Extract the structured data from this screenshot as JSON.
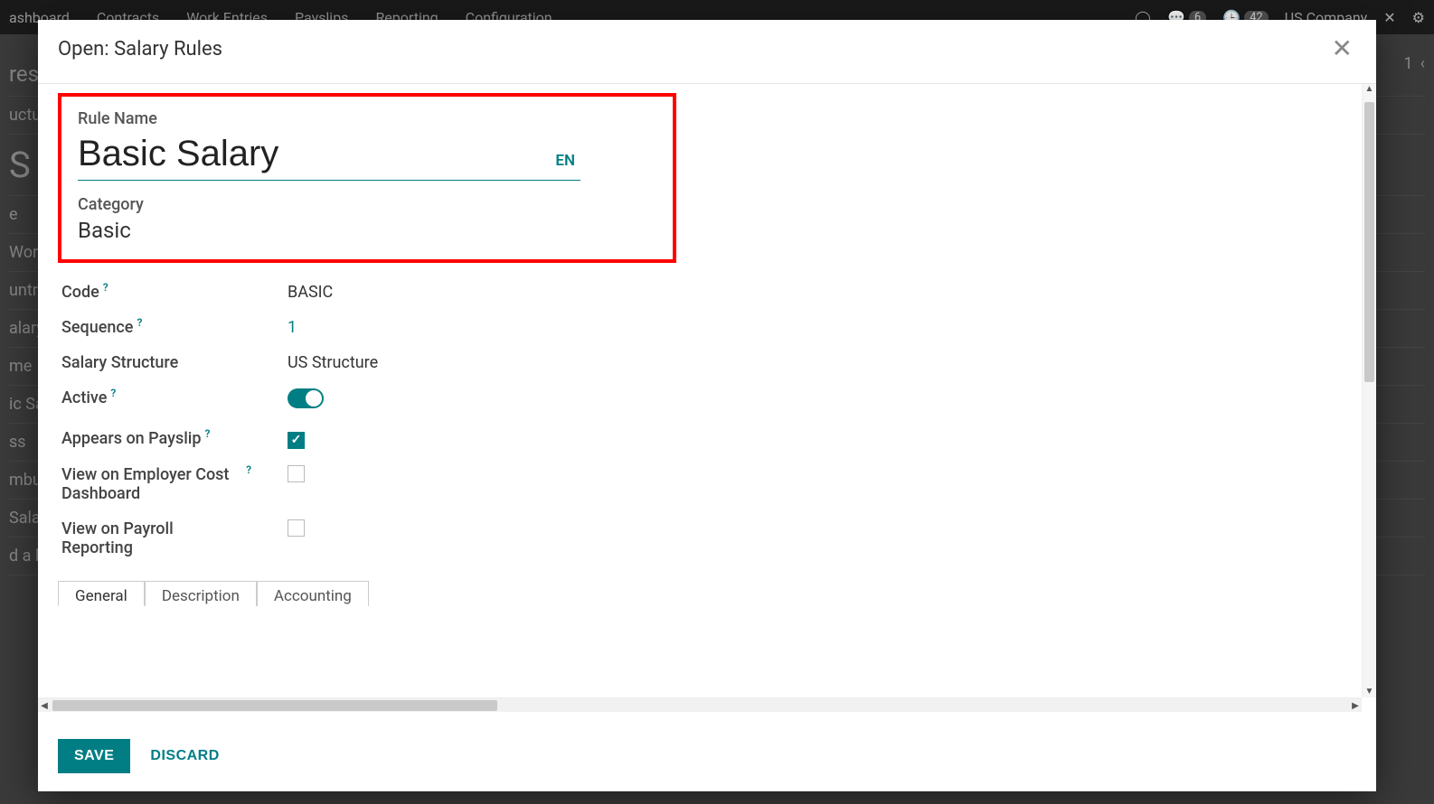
{
  "background": {
    "nav": [
      "ashboard",
      "Contracts",
      "Work Entries",
      "Payslips",
      "Reporting",
      "Configuration"
    ],
    "nav_right": {
      "chat_count": "6",
      "clock_count": "42",
      "company": "US Company"
    },
    "pager": "1",
    "left_fragments": [
      "res",
      "uctur",
      "S",
      "e",
      " Wor",
      "untry",
      "alary",
      "me",
      "ic Sa",
      "ss",
      "mbur",
      " Sala",
      "d a li"
    ]
  },
  "modal": {
    "title": "Open: Salary Rules",
    "rule_name_label": "Rule Name",
    "rule_name_value": "Basic Salary",
    "lang_badge": "EN",
    "category_label": "Category",
    "category_value": "Basic",
    "fields": {
      "code_label": "Code",
      "code_value": "BASIC",
      "sequence_label": "Sequence",
      "sequence_value": "1",
      "structure_label": "Salary Structure",
      "structure_value": "US Structure",
      "active_label": "Active",
      "appears_label": "Appears on Payslip",
      "employer_cost_label": "View on Employer Cost Dashboard",
      "payroll_reporting_label": "View on Payroll Reporting"
    },
    "tabs": [
      "General",
      "Description",
      "Accounting"
    ],
    "footer": {
      "save": "SAVE",
      "discard": "DISCARD"
    }
  }
}
